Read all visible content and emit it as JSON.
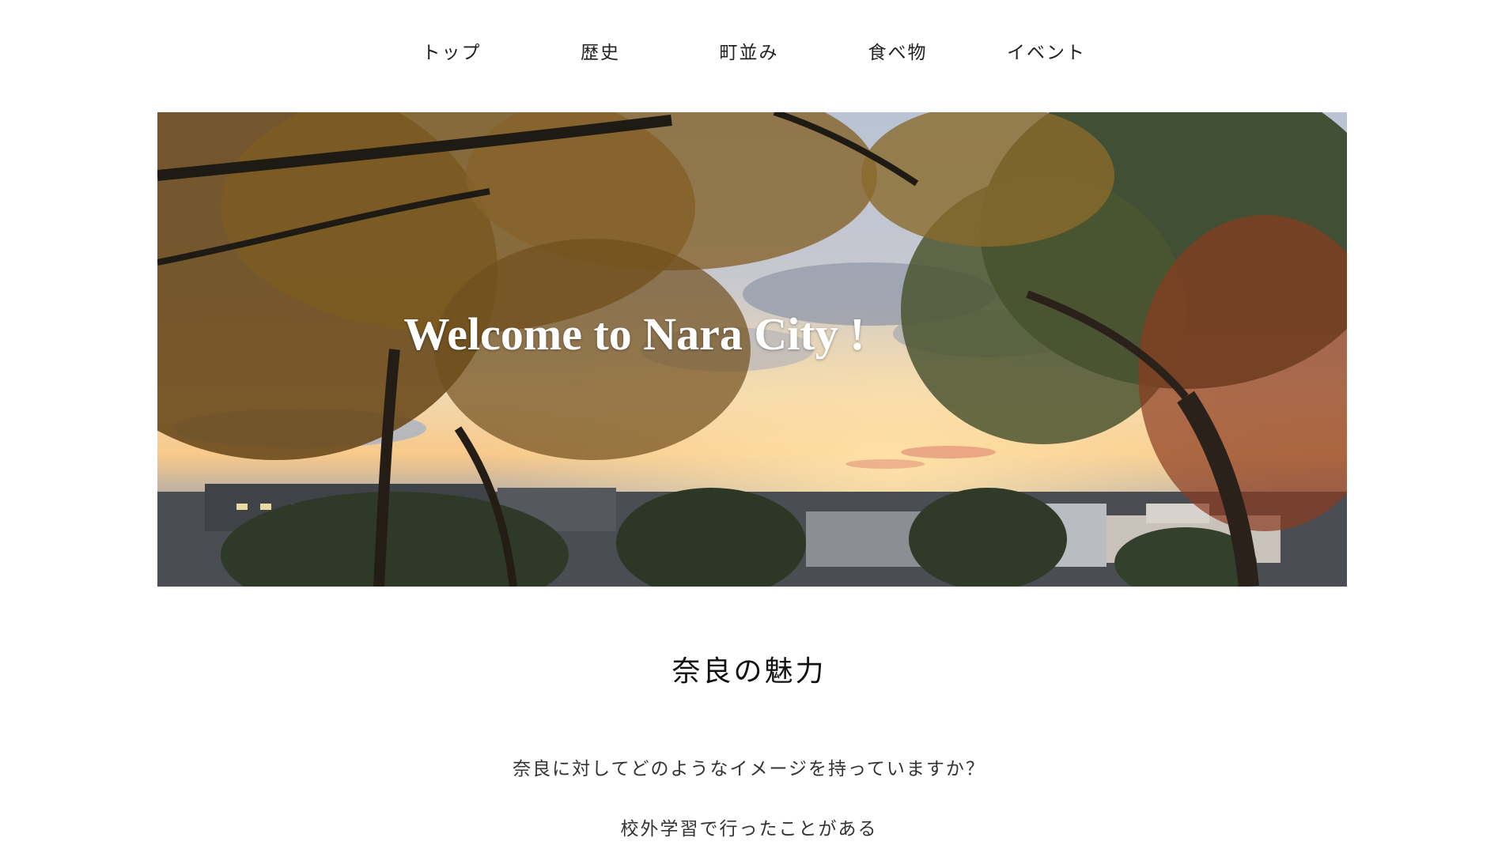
{
  "nav": {
    "items": [
      {
        "label": "トップ"
      },
      {
        "label": "歴史"
      },
      {
        "label": "町並み"
      },
      {
        "label": "食べ物"
      },
      {
        "label": "イベント"
      }
    ]
  },
  "hero": {
    "title": "Welcome to Nara City !",
    "image": "autumn-trees-sunset-photo"
  },
  "section": {
    "title": "奈良の魅力",
    "paragraphs": [
      "奈良に対してどのようなイメージを持っていますか？",
      "校外学習で行ったことがある"
    ]
  }
}
